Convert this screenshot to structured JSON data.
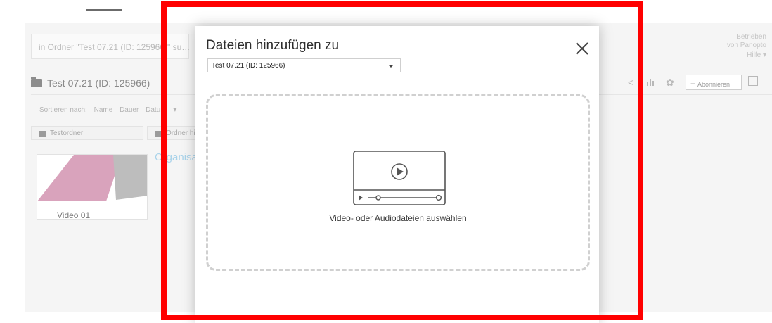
{
  "background": {
    "search_placeholder": "in Ordner \"Test 07.21 (ID: 125966)\" su…",
    "powered_by_line1": "Betrieben",
    "powered_by_line2": "von Panopto",
    "help_label": "Hilfe",
    "folder_title": "Test 07.21 (ID: 125966)",
    "sort_label": "Sortieren nach:",
    "sort_options": [
      "Name",
      "Dauer",
      "Datum"
    ],
    "subfolders": [
      "Testordner",
      "Ordner hi"
    ],
    "video_title": "Organisa",
    "video_label": "Video 01",
    "subscribe_label": "Abonnieren"
  },
  "modal": {
    "title": "Dateien hinzufügen zu",
    "selected_folder": "Test 07.21 (ID: 125966)",
    "drop_zone_text": "Video- oder Audiodateien auswählen"
  },
  "colors": {
    "highlight_frame": "#ff0000",
    "thumbnail_pink": "#d9a3bc",
    "link_blue": "#a9d3ea"
  },
  "icons": {
    "close": "close-icon",
    "dropdown": "chevron-down-icon",
    "upload": "video-player-icon",
    "folder": "folder-icon",
    "share": "share-icon",
    "stats": "bar-chart-icon",
    "settings": "gear-icon",
    "external": "external-link-icon"
  }
}
